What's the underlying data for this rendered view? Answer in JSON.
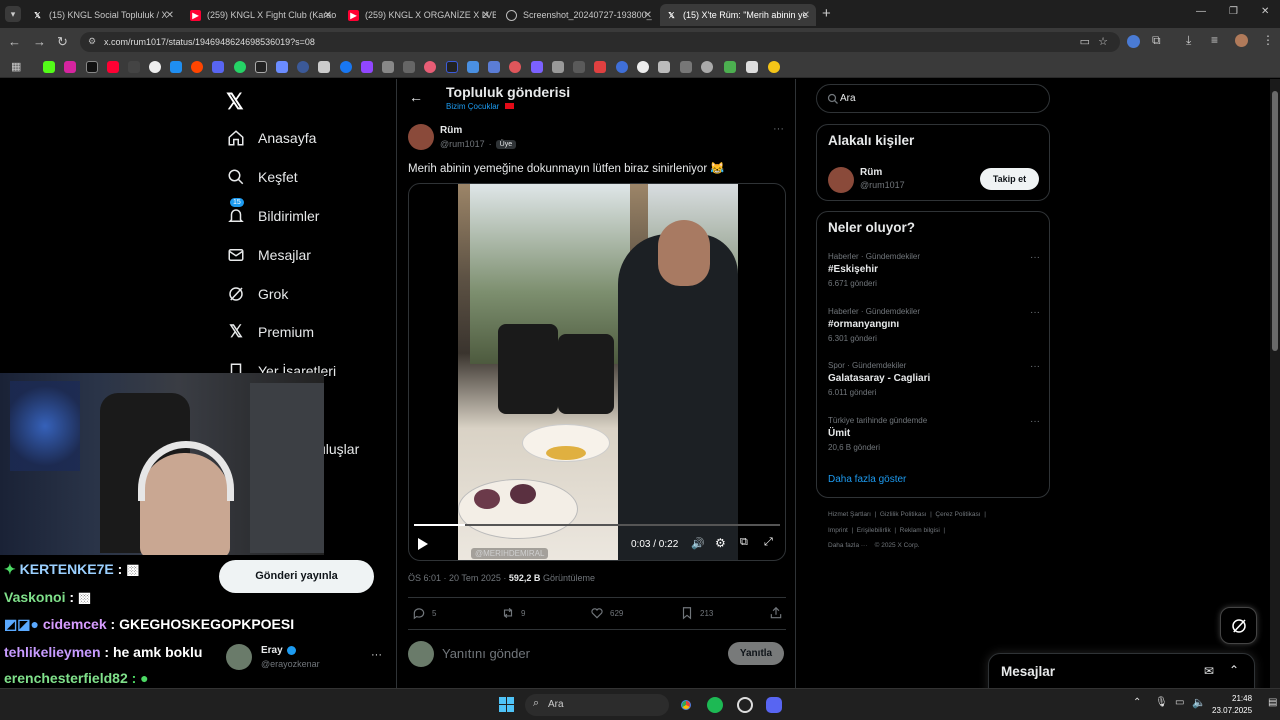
{
  "browser": {
    "tabs": [
      {
        "title": "(15) KNGL Social Topluluk / X",
        "icon": "x-logo-icon",
        "active": false
      },
      {
        "title": "(259) KNGL X Fight Club (Karao",
        "icon": "youtube-icon",
        "active": false
      },
      {
        "title": "(259) KNGL X ORGANİZE X LVB",
        "icon": "youtube-icon",
        "active": false
      },
      {
        "title": "Screenshot_20240727-193800_",
        "icon": "globe-icon",
        "active": false
      },
      {
        "title": "(15) X'te Rüm: \"Merih abinin ye",
        "icon": "x-logo-icon",
        "active": true
      }
    ],
    "url": "x.com/rum1017/status/1946948624698536019?s=08",
    "new_tab": "+"
  },
  "sidebar": {
    "items": [
      {
        "label": "Anasayfa",
        "icon": "home-icon"
      },
      {
        "label": "Keşfet",
        "icon": "search-icon"
      },
      {
        "label": "Bildirimler",
        "icon": "bell-icon",
        "badge": "15"
      },
      {
        "label": "Mesajlar",
        "icon": "mail-icon"
      },
      {
        "label": "Grok",
        "icon": "grok-icon"
      },
      {
        "label": "Premium",
        "icon": "x-logo-icon"
      },
      {
        "label": "Yer İşaretleri",
        "icon": "bookmark-icon"
      }
    ],
    "partial_label": "uluşlar",
    "post_button": "Gönderi yayınla",
    "account": {
      "name": "Eray",
      "handle": "@erayozkenar"
    }
  },
  "header": {
    "title": "Topluluk gönderisi",
    "community": "Bizim Çocuklar"
  },
  "post": {
    "author": "Rüm",
    "handle": "@rum1017",
    "separator": "·",
    "badge": "Üye",
    "text": "Merih abinin yemeğine dokunmayın lütfen biraz sinirleniyor 😹",
    "video": {
      "time": "0:03 / 0:22",
      "progress": 0.14,
      "watermark": "@MERIHDEMIRAL"
    },
    "time": "ÖS 6:01 · 20 Tem 2025 ·",
    "views": "592,2 B",
    "views_label": "Görüntüleme",
    "replies": "5",
    "reposts": "9",
    "likes": "629",
    "bookmarks": "213",
    "reply_placeholder": "Yanıtını gönder",
    "reply_button": "Yanıtla"
  },
  "right": {
    "search_placeholder": "Ara",
    "people_title": "Alakalı kişiler",
    "person": {
      "name": "Rüm",
      "handle": "@rum1017",
      "follow": "Takip et"
    },
    "trends_title": "Neler oluyor?",
    "trends": [
      {
        "meta": "Haberler · Gündemdekiler",
        "name": "#Eskişehir",
        "count": "6.671 gönderi"
      },
      {
        "meta": "Haberler · Gündemdekiler",
        "name": "#ormanyangını",
        "count": "6.301 gönderi"
      },
      {
        "meta": "Spor · Gündemdekiler",
        "name": "Galatasaray - Cagliari",
        "count": "6.011 gönderi"
      },
      {
        "meta": "Türkiye tarihinde gündemde",
        "name": "Ümit",
        "count": "20,6 B gönderi"
      }
    ],
    "show_more": "Daha fazla göster",
    "footer": {
      "line1": [
        "Hizmet Şartları",
        "Gizlilik Politikası",
        "Çerez Politikası"
      ],
      "line2": [
        "Imprint",
        "Erişilebilirlik",
        "Reklam bilgisi"
      ],
      "more": "Daha fazla ···",
      "copyright": "© 2025 X Corp."
    },
    "messages_title": "Mesajlar"
  },
  "chat": [
    {
      "prefix": "✦",
      "user": "KERTENKE7E",
      "msg": " : ▩",
      "color": "#9bd0ff",
      "prefix_color": "#4cd964"
    },
    {
      "prefix": "",
      "user": "Vaskonoi",
      "msg": " : ▩",
      "color": "#7fe08a",
      "prefix_color": "#fff"
    },
    {
      "prefix": "◩◪●",
      "user": "cidemcek",
      "msg": " : GKEGHOSKEGOPKPOESI",
      "color": "#d79cff",
      "prefix_color": "#5aa9ff"
    },
    {
      "prefix": "",
      "user": "tehlikelieymen",
      "msg": " : he amk boklu",
      "color": "#c79bff",
      "prefix_color": "#fff"
    },
    {
      "prefix": "",
      "user": "erenchesterfield82",
      "msg": " : ●",
      "color": "#7fe08a",
      "prefix_color": "#fff"
    }
  ],
  "taskbar": {
    "search": "Ara",
    "time": "21:48",
    "date": "23.07.2025"
  },
  "colors": {
    "accent": "#1d9bf0",
    "bg": "#000000",
    "border": "#2f3336",
    "muted": "#71767b"
  }
}
